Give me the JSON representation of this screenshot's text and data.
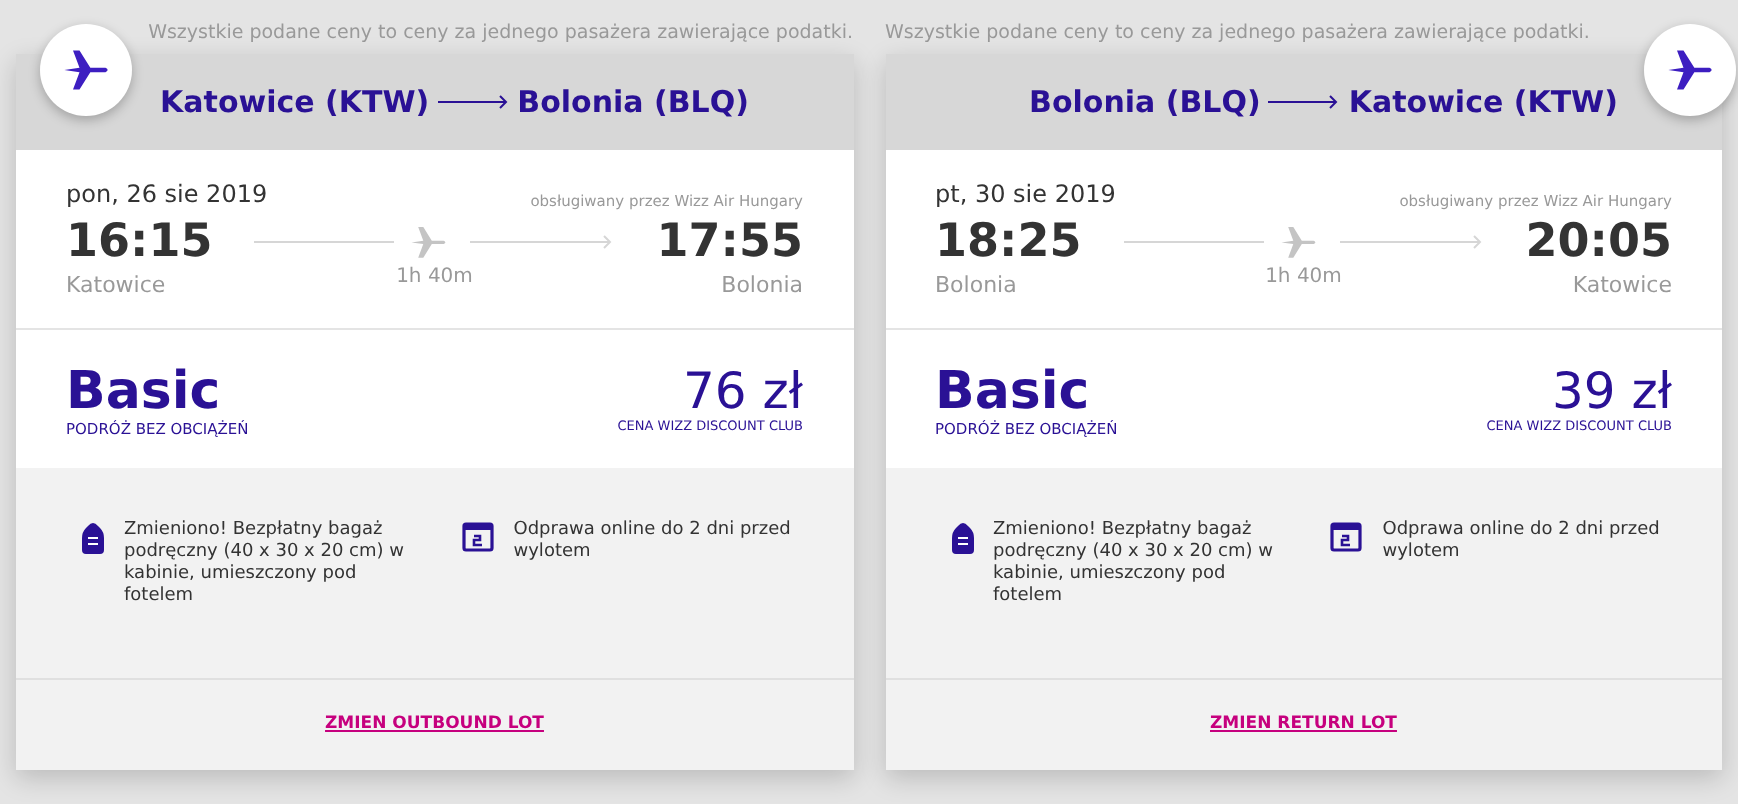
{
  "flights": [
    {
      "notice": "Wszystkie podane ceny to ceny za jednego pasażera zawierające podatki.",
      "from": "Katowice (KTW)",
      "to": "Bolonia (BLQ)",
      "date": "pon, 26 sie 2019",
      "operator": "obsługiwany przez Wizz Air Hungary",
      "departure_time": "16:15",
      "departure_city": "Katowice",
      "duration": "1h 40m",
      "arrival_time": "17:55",
      "arrival_city": "Bolonia",
      "fare": "Basic",
      "fare_subtitle": "PODRÓŻ BEZ OBCIĄŻEŃ",
      "price": "76 zł",
      "price_note": "CENA WIZZ DISCOUNT CLUB",
      "features": [
        {
          "kind": "bag",
          "text": "Zmieniono! Bezpłatny bagaż podręczny (40 x 30 x 20 cm) w kabinie, umieszczony pod fotelem"
        },
        {
          "kind": "calendar",
          "text": "Odprawa online do 2 dni przed wylotem"
        }
      ],
      "change_link": "ZMIEN OUTBOUND LOT"
    },
    {
      "notice": "Wszystkie podane ceny to ceny za jednego pasażera zawierające podatki.",
      "from": "Bolonia (BLQ)",
      "to": "Katowice (KTW)",
      "date": "pt, 30 sie 2019",
      "operator": "obsługiwany przez Wizz Air Hungary",
      "departure_time": "18:25",
      "departure_city": "Bolonia",
      "duration": "1h 40m",
      "arrival_time": "20:05",
      "arrival_city": "Katowice",
      "fare": "Basic",
      "fare_subtitle": "PODRÓŻ BEZ OBCIĄŻEŃ",
      "price": "39 zł",
      "price_note": "CENA WIZZ DISCOUNT CLUB",
      "features": [
        {
          "kind": "bag",
          "text": "Zmieniono! Bezpłatny bagaż podręczny (40 x 30 x 20 cm) w kabinie, umieszczony pod fotelem"
        },
        {
          "kind": "calendar",
          "text": "Odprawa online do 2 dni przed wylotem"
        }
      ],
      "change_link": "ZMIEN RETURN LOT"
    }
  ]
}
